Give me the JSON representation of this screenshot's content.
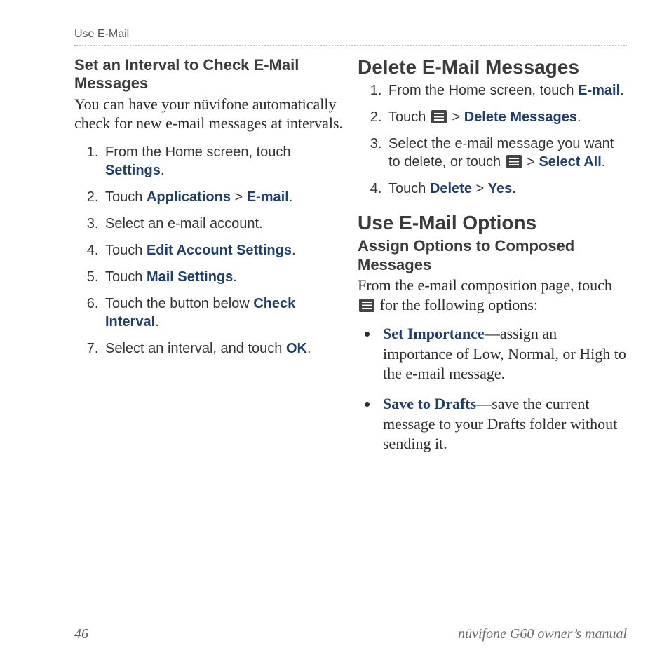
{
  "running_head": "Use E-Mail",
  "left": {
    "subheading": "Set an Interval to Check E-Mail Messages",
    "intro": "You can have your nüvifone automatically check for new e-mail messages at intervals.",
    "steps": [
      {
        "pre": "From the Home screen, touch ",
        "ui1": "Settings",
        "post1": "."
      },
      {
        "pre": "Touch ",
        "ui1": "Applications",
        "mid1": " > ",
        "ui2": "E-mail",
        "post2": "."
      },
      {
        "pre": "Select an e-mail account."
      },
      {
        "pre": "Touch ",
        "ui1": "Edit Account Settings",
        "post1": "."
      },
      {
        "pre": "Touch ",
        "ui1": "Mail Settings",
        "post1": "."
      },
      {
        "pre": "Touch the button below ",
        "ui1": "Check Interval",
        "post1": "."
      },
      {
        "pre": "Select an interval, and touch ",
        "ui1": "OK",
        "post1": "."
      }
    ]
  },
  "right": {
    "heading1": "Delete E-Mail Messages",
    "steps1": [
      {
        "pre": "From the Home screen, touch ",
        "ui1": "E-mail",
        "post1": "."
      },
      {
        "pre": "Touch ",
        "icon_after_pre": true,
        "mid1": " > ",
        "ui1": "Delete Messages",
        "post1": "."
      },
      {
        "pre": "Select the e-mail message you want to delete, or touch ",
        "icon_after_pre": true,
        "mid1": " > ",
        "ui1": "Select All",
        "post1": "."
      },
      {
        "pre": "Touch ",
        "ui1": "Delete",
        "mid1": " > ",
        "ui2": "Yes",
        "post2": "."
      }
    ],
    "heading2": "Use E-Mail Options",
    "subheading2": "Assign Options to Composed Messages",
    "intro2_pre": "From the e-mail composition page, touch ",
    "intro2_post": " for the following options:",
    "bullets": [
      {
        "term": "Set Importance",
        "desc": "—assign an importance of Low, Normal, or High to the e-mail message."
      },
      {
        "term": "Save to Drafts",
        "desc": "—save the current message to your Drafts folder without sending it."
      }
    ]
  },
  "footer": {
    "page": "46",
    "manual": "nüvifone G60 owner’s manual"
  }
}
